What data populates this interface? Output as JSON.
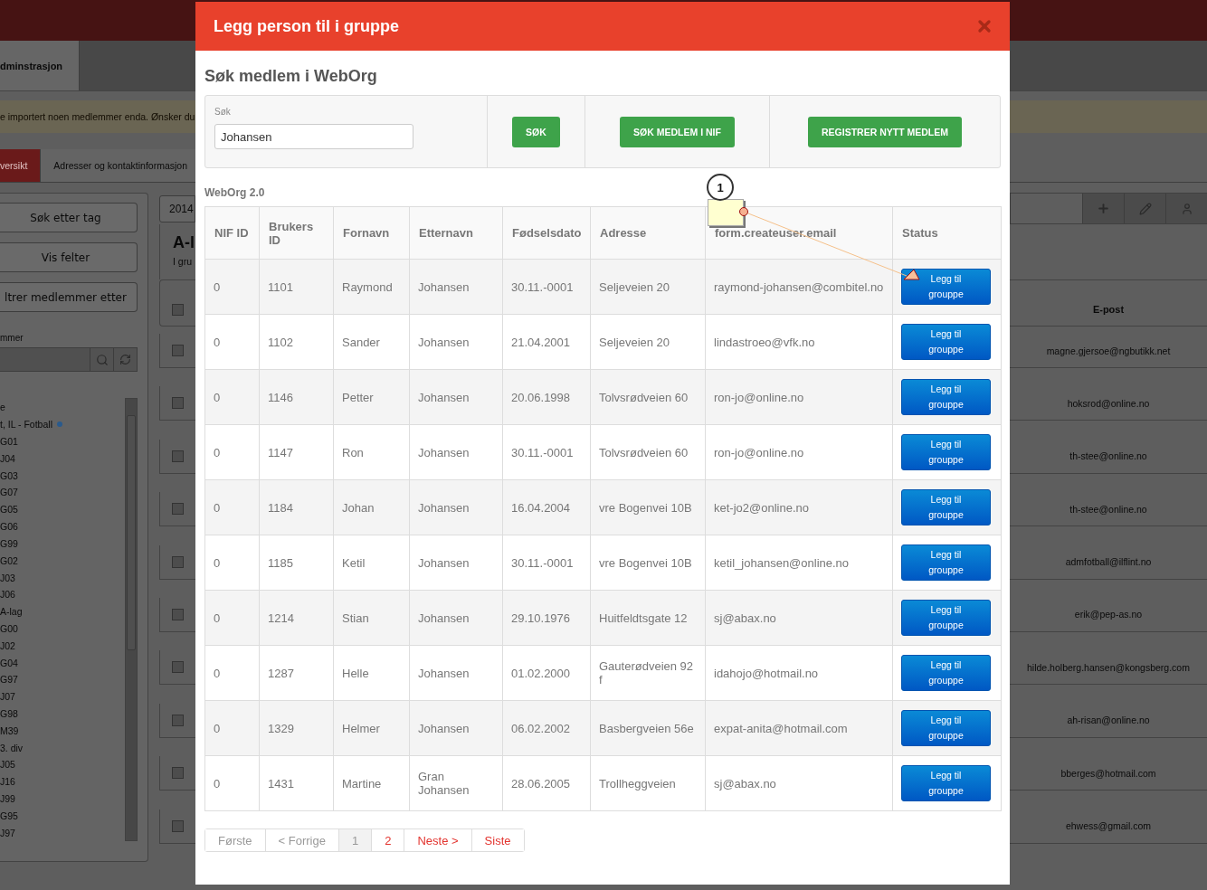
{
  "background": {
    "nav_tab": "dminstrasjon",
    "alert": "e importert noen medlemmer enda. Ønsker du",
    "tabs": [
      {
        "label": "versikt",
        "selected": true
      },
      {
        "label": "Adresser og kontaktinformasjon",
        "selected": false
      }
    ],
    "sidebar": {
      "buttons": [
        "Søk etter tag",
        "Vis felter",
        "ltrer medlemmer etter"
      ],
      "search_label": "mmer",
      "list": [
        {
          "label": "e",
          "marked": false
        },
        {
          "label": "t, IL - Fotball",
          "marked": true
        },
        {
          "label": "G01",
          "marked": false
        },
        {
          "label": "J04",
          "marked": false
        },
        {
          "label": "G03",
          "marked": false
        },
        {
          "label": "G07",
          "marked": false
        },
        {
          "label": "G05",
          "marked": false
        },
        {
          "label": "G06",
          "marked": false
        },
        {
          "label": "G99",
          "marked": false
        },
        {
          "label": "G02",
          "marked": false
        },
        {
          "label": "J03",
          "marked": false
        },
        {
          "label": "J06",
          "marked": false
        },
        {
          "label": "A-lag",
          "marked": false
        },
        {
          "label": "G00",
          "marked": false
        },
        {
          "label": "J02",
          "marked": false
        },
        {
          "label": "G04",
          "marked": false
        },
        {
          "label": "G97",
          "marked": false
        },
        {
          "label": "J07",
          "marked": false
        },
        {
          "label": "G98",
          "marked": false
        },
        {
          "label": "M39",
          "marked": false
        },
        {
          "label": "3. div",
          "marked": false
        },
        {
          "label": "J05",
          "marked": false
        },
        {
          "label": "J16",
          "marked": false
        },
        {
          "label": "J99",
          "marked": false
        },
        {
          "label": "G95",
          "marked": false
        },
        {
          "label": "J97",
          "marked": false
        }
      ]
    },
    "year": "2014",
    "group_title": "A-l",
    "group_subtitle": "I gru",
    "select_all_checked": false,
    "email_header": "E-post",
    "members": [
      {
        "checked": false,
        "email": "magne.gjersoe@ngbutikk.net"
      },
      {
        "checked": false,
        "email": "hoksrod@online.no"
      },
      {
        "checked": false,
        "email": "th-stee@online.no"
      },
      {
        "checked": false,
        "email": "th-stee@online.no"
      },
      {
        "checked": false,
        "email": "admfotball@ilflint.no"
      },
      {
        "checked": false,
        "email": "erik@pep-as.no"
      },
      {
        "checked": false,
        "email": "hilde.holberg.hansen@kongsberg.com"
      },
      {
        "checked": false,
        "email": "ah-risan@online.no"
      },
      {
        "checked": false,
        "email": "bberges@hotmail.com"
      },
      {
        "checked": false,
        "email": "ehwess@gmail.com"
      }
    ]
  },
  "modal": {
    "title": "Legg person til i gruppe",
    "search_title": "Søk medlem i WebOrg",
    "search": {
      "label": "Søk",
      "value": "Johansen"
    },
    "buttons": [
      "SØK",
      "SØK MEDLEM I NIF",
      "REGISTRER NYTT MEDLEM"
    ],
    "source_label": "WebOrg 2.0",
    "annotation": "1",
    "table": {
      "columns": [
        "NIF ID",
        "Brukers ID",
        "Fornavn",
        "Etternavn",
        "Fødselsdato",
        "Adresse",
        "form.createuser.email",
        "Status"
      ],
      "rows": [
        {
          "cells": [
            "0",
            "1101",
            "Raymond",
            "Johansen",
            "30.11.-0001",
            "Seljeveien 20",
            "raymond-johansen@combitel.no"
          ],
          "action": "Legg til grouppe"
        },
        {
          "cells": [
            "0",
            "1102",
            "Sander",
            "Johansen",
            "21.04.2001",
            "Seljeveien 20",
            "lindastroeo@vfk.no"
          ],
          "action": "Legg til grouppe"
        },
        {
          "cells": [
            "0",
            "1146",
            "Petter",
            "Johansen",
            "20.06.1998",
            "Tolvsrødveien 60",
            "ron-jo@online.no"
          ],
          "action": "Legg til grouppe"
        },
        {
          "cells": [
            "0",
            "1147",
            "Ron",
            "Johansen",
            "30.11.-0001",
            "Tolvsrødveien 60",
            "ron-jo@online.no"
          ],
          "action": "Legg til grouppe"
        },
        {
          "cells": [
            "0",
            "1184",
            "Johan",
            "Johansen",
            "16.04.2004",
            "vre Bogenvei 10B",
            "ket-jo2@online.no"
          ],
          "action": "Legg til grouppe"
        },
        {
          "cells": [
            "0",
            "1185",
            "Ketil",
            "Johansen",
            "30.11.-0001",
            "vre Bogenvei 10B",
            "ketil_johansen@online.no"
          ],
          "action": "Legg til grouppe"
        },
        {
          "cells": [
            "0",
            "1214",
            "Stian",
            "Johansen",
            "29.10.1976",
            "Huitfeldtsgate 12",
            "sj@abax.no"
          ],
          "action": "Legg til grouppe"
        },
        {
          "cells": [
            "0",
            "1287",
            "Helle",
            "Johansen",
            "01.02.2000",
            "Gauterødveien 92 f",
            "idahojo@hotmail.no"
          ],
          "action": "Legg til grouppe"
        },
        {
          "cells": [
            "0",
            "1329",
            "Helmer",
            "Johansen",
            "06.02.2002",
            "Basbergveien 56e",
            "expat-anita@hotmail.com"
          ],
          "action": "Legg til grouppe"
        },
        {
          "cells": [
            "0",
            "1431",
            "Martine",
            "Gran Johansen",
            "28.06.2005",
            "Trollheggveien",
            "sj@abax.no"
          ],
          "action": "Legg til grouppe"
        }
      ]
    },
    "pagination": [
      {
        "label": "Første",
        "selected": false,
        "disabled": true
      },
      {
        "label": "< Forrige",
        "selected": false,
        "disabled": true
      },
      {
        "label": "1",
        "selected": true,
        "disabled": false
      },
      {
        "label": "2",
        "selected": false,
        "disabled": false
      },
      {
        "label": "Neste >",
        "selected": false,
        "disabled": false
      },
      {
        "label": "Siste",
        "selected": false,
        "disabled": false
      }
    ]
  }
}
